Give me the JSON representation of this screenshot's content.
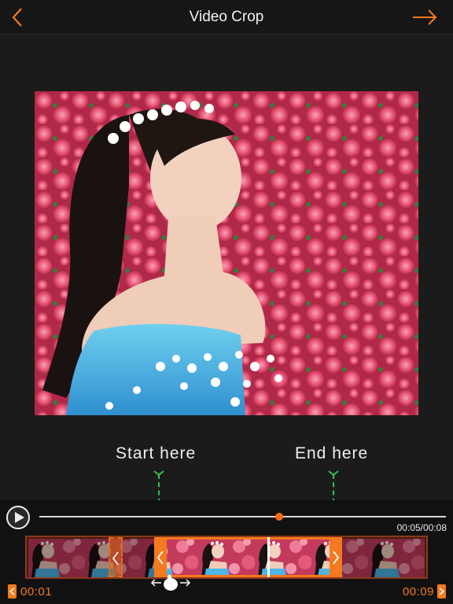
{
  "header": {
    "title": "Video Crop",
    "back_icon": "chevron-left-icon",
    "next_icon": "arrow-right-icon"
  },
  "markers": {
    "start_label": "Start here",
    "end_label": "End here"
  },
  "playback": {
    "play_icon": "play-icon",
    "time_readout": "00:05/00:08",
    "progress": 0.59
  },
  "trim": {
    "start_time": "00:01",
    "end_time": "00:09"
  },
  "colors": {
    "accent": "#f47a1f",
    "marker": "#36c34a",
    "background": "#1b1b1b"
  }
}
